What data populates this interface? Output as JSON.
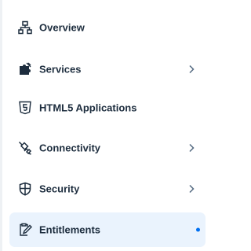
{
  "colors": {
    "text": "#1d2d3e",
    "selected_background": "#eaf3fd",
    "accent": "#0070f2",
    "chevron": "#556b82"
  },
  "nav": {
    "items": [
      {
        "label": "Overview",
        "icon": "sitemap-icon",
        "has_children": false,
        "selected": false
      },
      {
        "label": "Services",
        "icon": "puzzle-icon",
        "has_children": true,
        "selected": false
      },
      {
        "label": "HTML5 Applications",
        "icon": "html5-icon",
        "has_children": false,
        "selected": false
      },
      {
        "label": "Connectivity",
        "icon": "connectivity-icon",
        "has_children": true,
        "selected": false
      },
      {
        "label": "Security",
        "icon": "shield-icon",
        "has_children": true,
        "selected": false
      },
      {
        "label": "Entitlements",
        "icon": "entitlements-icon",
        "has_children": false,
        "selected": true
      }
    ]
  }
}
